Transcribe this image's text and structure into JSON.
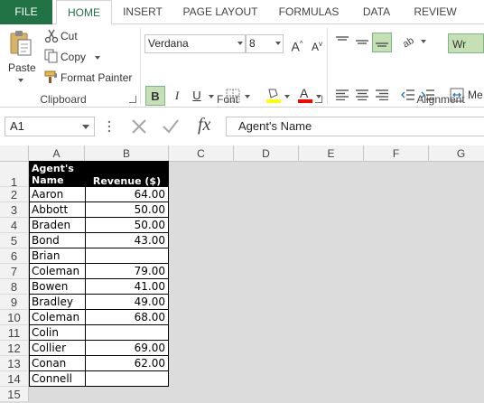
{
  "tabs": {
    "file": "FILE",
    "home": "HOME",
    "insert": "INSERT",
    "page_layout": "PAGE LAYOUT",
    "formulas": "FORMULAS",
    "data": "DATA",
    "review": "REVIEW"
  },
  "clipboard": {
    "paste": "Paste",
    "cut": "Cut",
    "copy": "Copy",
    "format_painter": "Format Painter",
    "group_label": "Clipboard"
  },
  "font": {
    "font_name": "Verdana",
    "font_size": "8",
    "bold": "B",
    "italic": "I",
    "underline": "U",
    "grow": "A",
    "shrink": "A",
    "font_color_glyph": "A",
    "group_label": "Font",
    "fill_color": "#ffff00",
    "text_color": "#ff0000"
  },
  "alignment": {
    "wrap": "Wr",
    "merge": "Me",
    "group_label": "Alignment"
  },
  "formula_bar": {
    "name_box": "A1",
    "fx": "fx",
    "content": "Agent's Name"
  },
  "columns": [
    "A",
    "B",
    "C",
    "D",
    "E",
    "F",
    "G"
  ],
  "rows": [
    "1",
    "2",
    "3",
    "4",
    "5",
    "6",
    "7",
    "8",
    "9",
    "10",
    "11",
    "12",
    "13",
    "14",
    "15"
  ],
  "table": {
    "header_a": "Agent's Name",
    "header_b": "Revenue ($)",
    "data": [
      {
        "name": "Aaron",
        "revenue": "64.00"
      },
      {
        "name": "Abbott",
        "revenue": "50.00"
      },
      {
        "name": "Braden",
        "revenue": "50.00"
      },
      {
        "name": "Bond",
        "revenue": "43.00"
      },
      {
        "name": "Brian",
        "revenue": ""
      },
      {
        "name": "Coleman",
        "revenue": "79.00"
      },
      {
        "name": "Bowen",
        "revenue": "41.00"
      },
      {
        "name": "Bradley",
        "revenue": "49.00"
      },
      {
        "name": "Coleman",
        "revenue": "68.00"
      },
      {
        "name": "Colin",
        "revenue": ""
      },
      {
        "name": "Collier",
        "revenue": "69.00"
      },
      {
        "name": "Conan",
        "revenue": "62.00"
      },
      {
        "name": "Connell",
        "revenue": ""
      }
    ]
  },
  "colors": {
    "accent": "#217346",
    "active_button": "#c5e0b4"
  }
}
